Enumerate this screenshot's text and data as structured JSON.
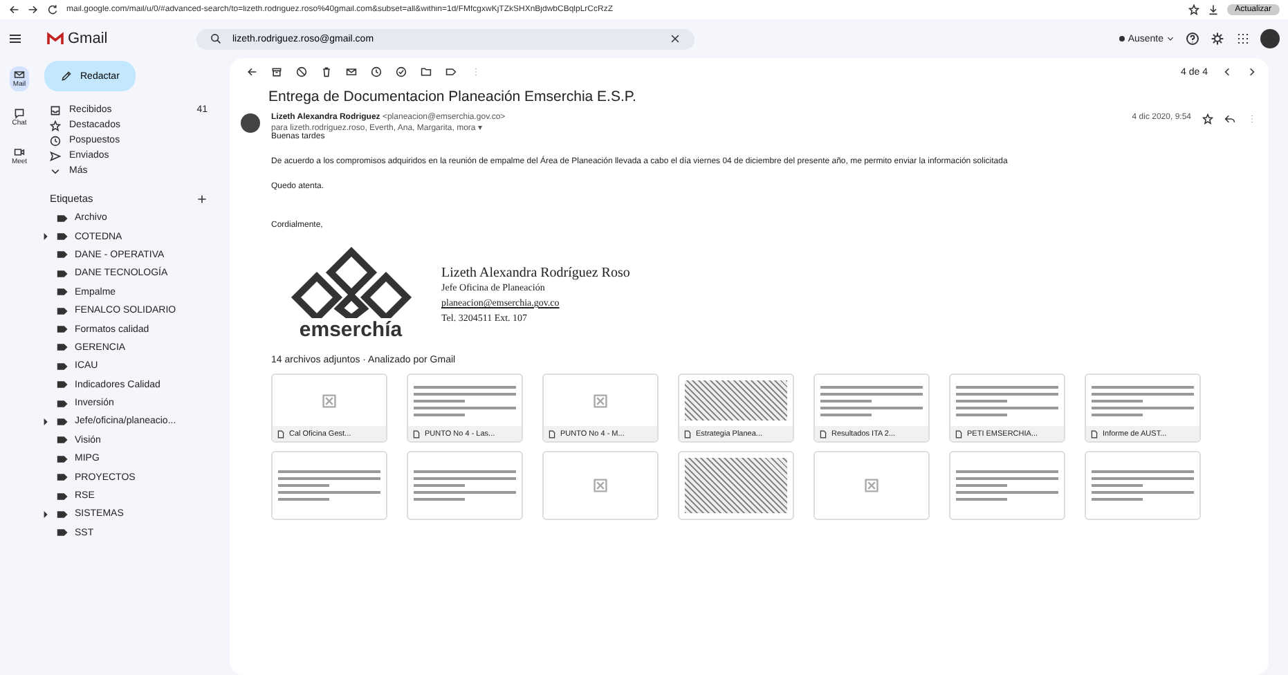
{
  "browser": {
    "url": "mail.google.com/mail/u/0/#advanced-search/to=lizeth.rodriguez.roso%40gmail.com&subset=all&within=1d/FMfcgxwKjTZkSHXnBjdwbCBqlpLrCcRzZ",
    "update_button": "Actualizar"
  },
  "header": {
    "logo": "Gmail",
    "search_value": "lizeth.rodriguez.roso@gmail.com",
    "status": "Ausente"
  },
  "rail": [
    {
      "label": "Mail",
      "selected": true
    },
    {
      "label": "Chat",
      "selected": false
    },
    {
      "label": "Meet",
      "selected": false
    }
  ],
  "compose": "Redactar",
  "folders": [
    {
      "label": "Recibidos",
      "count": "41",
      "selected": false
    },
    {
      "label": "Destacados",
      "selected": false
    },
    {
      "label": "Pospuestos",
      "selected": false
    },
    {
      "label": "Enviados",
      "selected": false
    },
    {
      "label": "Más",
      "selected": false
    }
  ],
  "labels_title": "Etiquetas",
  "labels": [
    {
      "label": "Archivo",
      "expandable": false
    },
    {
      "label": "COTEDNA",
      "expandable": true
    },
    {
      "label": "DANE - OPERATIVA",
      "expandable": false
    },
    {
      "label": "DANE TECNOLOGÍA",
      "expandable": false
    },
    {
      "label": "Empalme",
      "expandable": false
    },
    {
      "label": "FENALCO SOLIDARIO",
      "expandable": false
    },
    {
      "label": "Formatos calidad",
      "expandable": false
    },
    {
      "label": "GERENCIA",
      "expandable": false
    },
    {
      "label": "ICAU",
      "expandable": false
    },
    {
      "label": "Indicadores Calidad",
      "expandable": false
    },
    {
      "label": "Inversión",
      "expandable": false
    },
    {
      "label": "Jefe/oficina/planeacio...",
      "expandable": true
    },
    {
      "label": "Visión",
      "expandable": false
    },
    {
      "label": "MIPG",
      "expandable": false
    },
    {
      "label": "PROYECTOS",
      "expandable": false
    },
    {
      "label": "RSE",
      "expandable": false
    },
    {
      "label": "SISTEMAS",
      "expandable": true
    },
    {
      "label": "SST",
      "expandable": false
    }
  ],
  "toolbar": {
    "pager": "4 de 4"
  },
  "message": {
    "subject": "Entrega de Documentacion Planeación Emserchia E.S.P.",
    "sender": "Lizeth Alexandra Rodriguez",
    "sender_email": "<planeacion@emserchia.gov.co>",
    "recipients": "para lizeth.rodriguez.roso, Everth, Ana, Margarita, mora ▾",
    "date": "4 dic 2020, 9:54",
    "body": [
      "Buenas tardes",
      "De acuerdo a los compromisos adquiridos en la reunión de empalme del Área de Planeación llevada a cabo el día viernes 04 de diciembre del presente año, me permito enviar la información solicitada",
      "Quedo atenta.",
      "Cordialmente,"
    ],
    "signature": {
      "logo": "emserchía",
      "name": "Lizeth Alexandra Rodríguez Roso",
      "role": "Jefe Oficina de Planeación",
      "email": "planeacion@emserchia.gov.co",
      "phone": "Tel. 3204511 Ext. 107"
    }
  },
  "attachments": {
    "title": "14 archivos adjuntos · Analizado por Gmail",
    "items": [
      {
        "name": "Cal Oficina Gest...",
        "kind": "blank"
      },
      {
        "name": "PUNTO No 4 - Las...",
        "kind": "doc"
      },
      {
        "name": "PUNTO No 4 - M...",
        "kind": "blank"
      },
      {
        "name": "Estrategia Planea...",
        "kind": "dense"
      },
      {
        "name": "Resultados ITA 2...",
        "kind": "doc"
      },
      {
        "name": "PETI EMSERCHIA...",
        "kind": "doc"
      },
      {
        "name": "Informe de AUST...",
        "kind": "doc"
      },
      {
        "kind": "doc"
      },
      {
        "kind": "doc"
      },
      {
        "kind": "blank"
      },
      {
        "kind": "dense"
      },
      {
        "kind": "blank"
      },
      {
        "kind": "doc"
      },
      {
        "kind": "doc"
      }
    ]
  }
}
